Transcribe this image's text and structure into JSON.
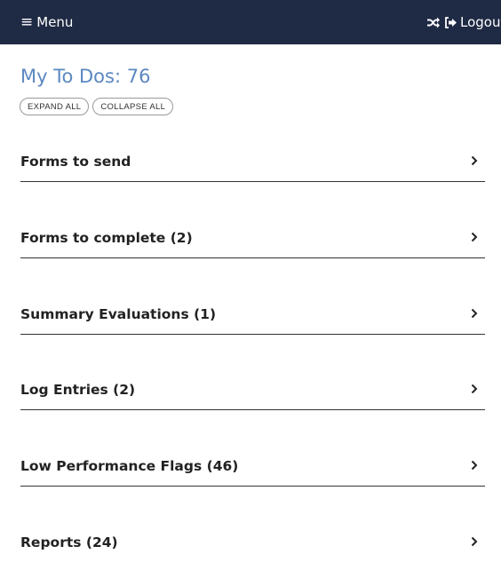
{
  "navbar": {
    "menu_icon": "≡",
    "menu_label": "Menu",
    "shuffle_icon": "shuffle-icon",
    "logout_icon": "sign-out-icon",
    "logout_label": "Logout",
    "background_color": "#1f2a44"
  },
  "todos": {
    "title": "My To Dos: 76",
    "title_color": "#5b88c2",
    "expand_all_label": "EXPAND ALL",
    "collapse_all_label": "COLLAPSE ALL"
  },
  "sections": [
    {
      "label": "Forms to send"
    },
    {
      "label": "Forms to complete (2)"
    },
    {
      "label": "Summary Evaluations (1)"
    },
    {
      "label": "Log Entries (2)"
    },
    {
      "label": "Low Performance Flags (46)"
    },
    {
      "label": "Reports (24)"
    }
  ]
}
